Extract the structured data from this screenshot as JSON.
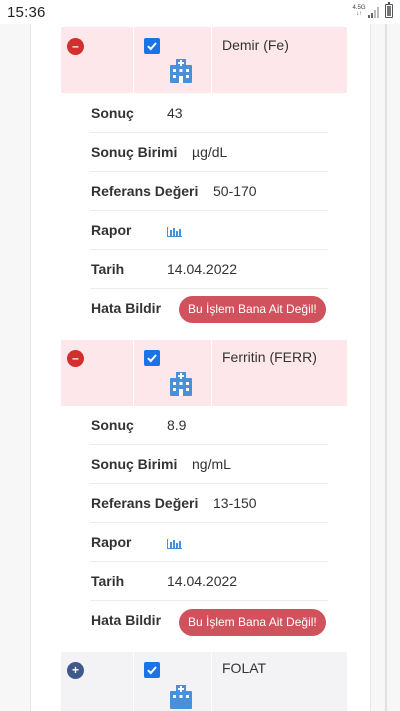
{
  "status_bar": {
    "time": "15:36",
    "network": "4.5G",
    "network_sub": "↓↑"
  },
  "tests": [
    {
      "name": "Demir (Fe)",
      "expanded": true,
      "checked": true,
      "result_label": "Sonuç",
      "result_value": "43",
      "unit_label": "Sonuç Birimi",
      "unit_value": "µg/dL",
      "ref_label": "Referans Değeri",
      "ref_value": "50-170",
      "report_label": "Rapor",
      "date_label": "Tarih",
      "date_value": "14.04.2022",
      "error_label": "Hata Bildir",
      "error_button": "Bu İşlem Bana Ait Değil!"
    },
    {
      "name": "Ferritin (FERR)",
      "expanded": true,
      "checked": true,
      "result_label": "Sonuç",
      "result_value": "8.9",
      "unit_label": "Sonuç Birimi",
      "unit_value": "ng/mL",
      "ref_label": "Referans Değeri",
      "ref_value": "13-150",
      "report_label": "Rapor",
      "date_label": "Tarih",
      "date_value": "14.04.2022",
      "error_label": "Hata Bildir",
      "error_button": "Bu İşlem Bana Ait Değil!"
    },
    {
      "name": "FOLAT",
      "expanded": false,
      "checked": true
    }
  ],
  "toggle_symbols": {
    "expanded": "–",
    "collapsed": "+"
  },
  "icons": {
    "toggle_expanded": "minus-circle-icon",
    "toggle_collapsed": "plus-circle-icon",
    "checkbox": "checkbox-checked-icon",
    "lab": "hospital-building-icon",
    "report": "bar-chart-icon"
  },
  "colors": {
    "expanded_row_bg": "#fde7ea",
    "collapsed_row_bg": "#f3f3f5",
    "minus_button": "#d32f2f",
    "plus_button": "#3f5a8a",
    "checkbox": "#1a73e8",
    "error_button": "#d0525c",
    "icon_blue": "#4a90d9"
  }
}
